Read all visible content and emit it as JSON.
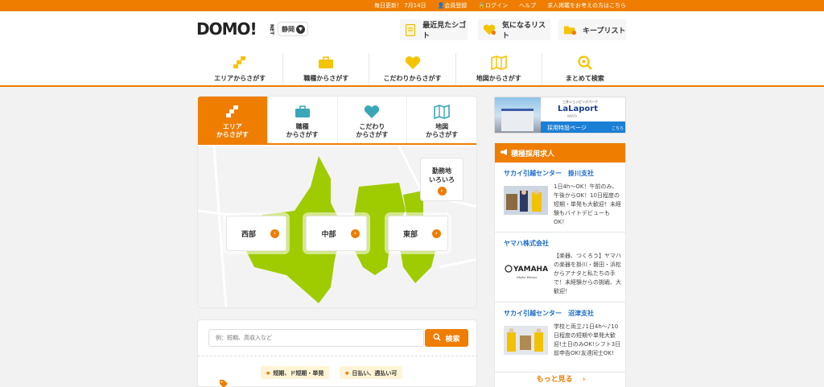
{
  "topbar": {
    "update": "毎日更新！ 7月14日",
    "register": "会員登録",
    "login": "ログイン",
    "help": "ヘルプ",
    "employer": "求人掲載をお考えの方はこちら"
  },
  "header": {
    "logo": "DOMO!",
    "logo_suffix": "NET",
    "region": "静岡",
    "shortcuts": [
      {
        "label": "最近見たシゴト",
        "icon": "document-icon"
      },
      {
        "label": "気になるリスト",
        "icon": "heart-icon"
      },
      {
        "label": "キープリスト",
        "icon": "folder-icon"
      }
    ],
    "categories": [
      {
        "label": "エリアからさがす",
        "icon": "area-icon"
      },
      {
        "label": "職種からさがす",
        "icon": "briefcase-icon"
      },
      {
        "label": "こだわりからさがす",
        "icon": "heart-icon"
      },
      {
        "label": "地図からさがす",
        "icon": "map-icon"
      },
      {
        "label": "まとめて検索",
        "icon": "search-icon"
      }
    ]
  },
  "search_tabs": [
    {
      "line1": "エリア",
      "line2": "からさがす",
      "icon": "area-icon",
      "active": true
    },
    {
      "line1": "職種",
      "line2": "からさがす",
      "icon": "briefcase-icon",
      "active": false
    },
    {
      "line1": "こだわり",
      "line2": "からさがす",
      "icon": "heart-icon",
      "active": false
    },
    {
      "line1": "地図",
      "line2": "からさがす",
      "icon": "map-icon",
      "active": false
    }
  ],
  "map": {
    "west": "西部",
    "central": "中部",
    "east": "東部",
    "work_line1": "勤務地",
    "work_line2": "いろいろ"
  },
  "keyword": {
    "placeholder": "例：短期、高収入など",
    "button": "検索",
    "tags": [
      "短期、ド短期・単発",
      "日払い、週払い可"
    ]
  },
  "banner": {
    "small": "三井ショッピングパーク",
    "brand": "LaLaport",
    "sub": "IWATA",
    "strip": "採用特設ページ",
    "strip_link": "こちら"
  },
  "featured_jobs": {
    "title": "積極採用求人",
    "items": [
      {
        "company": "サカイ引越センター　掛川支社",
        "desc": "1日4h～OK！午前のみ、午後からOK！10日程度の短期・単発も大歓迎！未経験もバイトデビューもOK！"
      },
      {
        "company": "ヤマハ株式会社",
        "desc": "【楽器、つくろう】ヤマハの楽器を掛川・磐田・浜松からアナタと私たちの手で！未経験からの挑戦、大歓迎！"
      },
      {
        "company": "サカイ引越センター　沼津支社",
        "desc": "学校と両立♪1日4h～♪10日程度の短期や単発大歓迎!土日のみOK!シフト3日前申告OK!友達同士OK!"
      }
    ],
    "yamaha_logo": "YAMAHA",
    "yamaha_tagline": "Make Waves",
    "more": "もっと見る"
  },
  "colors": {
    "accent": "#ee7d00",
    "map_green": "#9fcc00",
    "link": "#1b6bc9"
  }
}
